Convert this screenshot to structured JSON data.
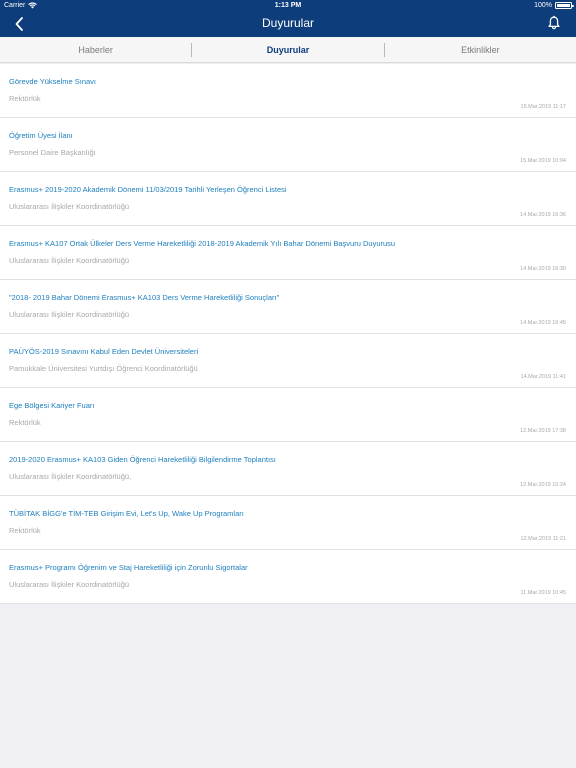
{
  "status_bar": {
    "carrier": "Carrier",
    "time": "1:13 PM",
    "battery": "100%"
  },
  "nav": {
    "title": "Duyurular",
    "back_icon": "chevron-left-icon",
    "bell_icon": "bell-icon"
  },
  "tabs": [
    {
      "label": "Haberler"
    },
    {
      "label": "Duyurular"
    },
    {
      "label": "Etkinlikler"
    }
  ],
  "colors": {
    "header": "#0d3d7a",
    "link": "#1d7fbd",
    "muted": "#a8a8a8"
  },
  "announcements": [
    {
      "title": "Görevde Yükselme Sınavı",
      "source": "Rektörlük",
      "date": "15.Mar.2019 11:17"
    },
    {
      "title": "Öğretim Üyesi İlanı",
      "source": "Personel Daire Başkanlığı",
      "date": "15.Mar.2019 10:04"
    },
    {
      "title": "Erasmus+ 2019-2020 Akademik Dönemi 11/03/2019 Tarihli Yerleşen Öğrenci Listesi",
      "source": "Uluslararası İlişkiler Koordinatörlüğü",
      "date": "14.Mar.2019 16:36"
    },
    {
      "title": "Erasmus+ KA107 Ortak Ülkeler Ders Verme Hareketliliği 2018-2019 Akademik Yılı Bahar Dönemi Başvuru Duyurusu",
      "source": "Uluslararası İlişkiler Koordinatörlüğü",
      "date": "14.Mar.2019 16:30"
    },
    {
      "title": "\"2018- 2019 Bahar Dönemi Erasmus+ KA103 Ders Verme Hareketliliği Sonuçları\"",
      "source": "Uluslararası İlişkiler Koordinatörlüğü",
      "date": "14.Mar.2019 16:45"
    },
    {
      "title": "PAÜYÖS-2019 Sınavını Kabul Eden Devlet Üniversiteleri",
      "source": "Pamukkale Üniversitesi Yurtdışı Öğrenci Koordinatörlüğü",
      "date": "14.Mar.2019 11:41"
    },
    {
      "title": "Ege Bölgesi Kariyer Fuarı",
      "source": "Rektörlük",
      "date": "12.Mar.2019 17:38"
    },
    {
      "title": "2019-2020 Erasmus+ KA103 Giden Öğrenci Hareketliliği Bilgilendirme Toplantısı",
      "source": "Uluslararası İlişkiler Koordinatörlüğü,",
      "date": "12.Mar.2019 15:24"
    },
    {
      "title": "TÜBİTAK BİGG'e TİM-TEB Girişim Evi, Let's Up, Wake Up Programları",
      "source": "Rektörlük",
      "date": "12.Mar.2019 11:21"
    },
    {
      "title": "Erasmus+ Programı Öğrenim ve Staj Hareketliliği için Zorunlu Sigortalar",
      "source": "Uluslararası İlişkiler Koordinatörlüğü",
      "date": "11.Mar.2019 10:45"
    }
  ]
}
